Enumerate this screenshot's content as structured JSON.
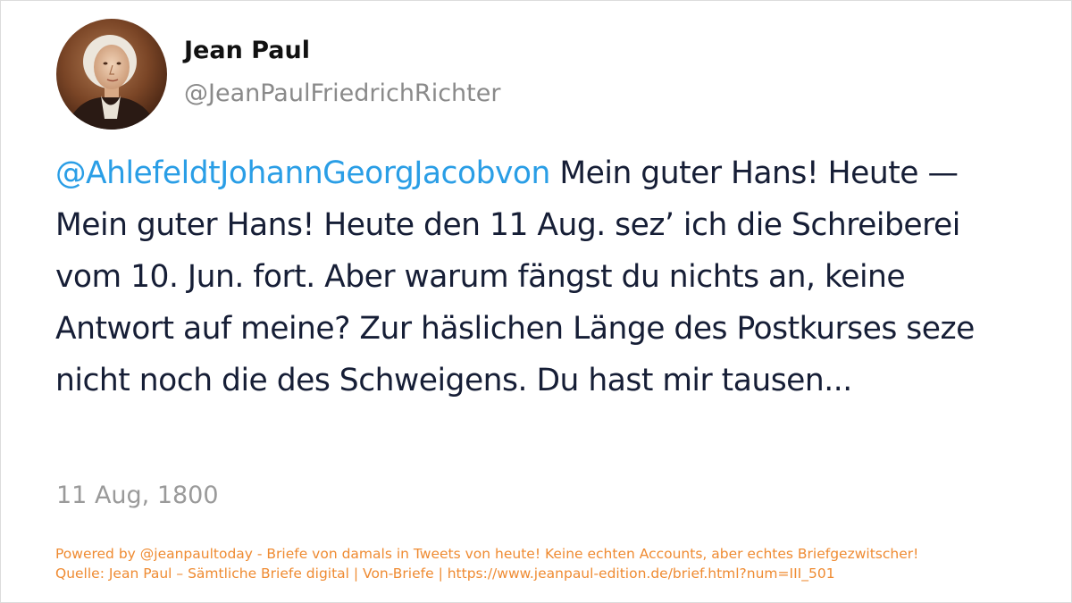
{
  "author": {
    "name": "Jean Paul",
    "handle": "@JeanPaulFriedrichRichter",
    "avatar_icon": "portrait-avatar-icon"
  },
  "tweet": {
    "mention": "@AhlefeldtJohannGeorgJacobvon",
    "text": " Mein guter Hans! Heute — Mein guter Hans! Heute den 11 Aug. sez’ ich die Schreiberei vom 10. Jun. fort. Aber warum fängst du nichts an, keine Antwort auf meine? Zur häslichen Länge des Postkurses seze nicht noch die des Schweigens. Du hast mir tausen...",
    "date": "11 Aug, 1800"
  },
  "footer": {
    "line1": "Powered by @jeanpaultoday - Briefe von damals in Tweets von heute! Keine echten Accounts, aber echtes Briefgezwitscher!",
    "line2": "Quelle: Jean Paul – Sämtliche Briefe digital | Von-Briefe | https://www.jeanpaul-edition.de/brief.html?num=III_501"
  },
  "colors": {
    "mention": "#2a9ee6",
    "text": "#161e36",
    "muted": "#9a9a9a",
    "footer": "#ef8b32"
  }
}
